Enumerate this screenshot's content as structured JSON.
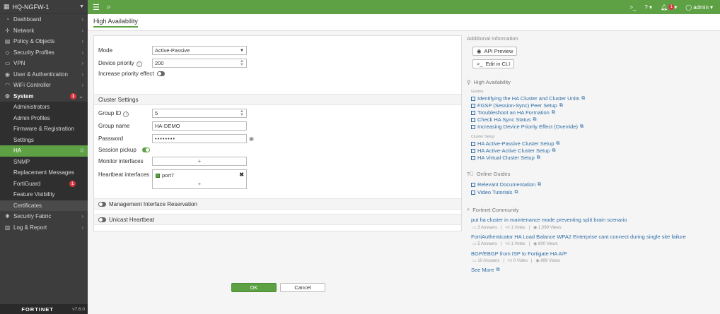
{
  "app": {
    "device_name": "HQ-NGFW-1",
    "logo": "FORTINET",
    "version": "v7.6.0"
  },
  "topbar": {
    "cli_icon": "terminal-icon",
    "help_icon": "help-icon",
    "bell_icon": "bell-icon",
    "notification_count": "1",
    "user": "admin"
  },
  "sidebar": {
    "items": [
      {
        "label": "Dashboard",
        "icon": "dashboard-icon"
      },
      {
        "label": "Network",
        "icon": "network-icon"
      },
      {
        "label": "Policy & Objects",
        "icon": "policy-icon"
      },
      {
        "label": "Security Profiles",
        "icon": "security-icon"
      },
      {
        "label": "VPN",
        "icon": "vpn-icon"
      },
      {
        "label": "User & Authentication",
        "icon": "user-icon"
      },
      {
        "label": "WiFi Controller",
        "icon": "wifi-icon"
      },
      {
        "label": "System",
        "icon": "gear-icon",
        "badge": "1"
      }
    ],
    "system_sub": [
      {
        "label": "Administrators"
      },
      {
        "label": "Admin Profiles"
      },
      {
        "label": "Firmware & Registration"
      },
      {
        "label": "Settings"
      },
      {
        "label": "HA"
      },
      {
        "label": "SNMP"
      },
      {
        "label": "Replacement Messages"
      },
      {
        "label": "FortiGuard",
        "badge": "1"
      },
      {
        "label": "Feature Visibility"
      },
      {
        "label": "Certificates"
      }
    ],
    "bottom_items": [
      {
        "label": "Security Fabric",
        "icon": "fabric-icon"
      },
      {
        "label": "Log & Report",
        "icon": "log-icon"
      }
    ]
  },
  "page": {
    "title": "High Availability"
  },
  "form": {
    "mode_label": "Mode",
    "mode_value": "Active-Passive",
    "device_priority_label": "Device priority",
    "device_priority_value": "200",
    "increase_priority_label": "Increase priority effect",
    "cluster_settings_heading": "Cluster Settings",
    "group_id_label": "Group ID",
    "group_id_value": "5",
    "group_name_label": "Group name",
    "group_name_value": "HA-DEMO",
    "password_label": "Password",
    "password_value": "••••••••",
    "session_pickup_label": "Session pickup",
    "monitor_interfaces_label": "Monitor interfaces",
    "add_symbol": "+",
    "heartbeat_interfaces_label": "Heartbeat interfaces",
    "heartbeat_port": "port7",
    "remove_symbol": "✖",
    "mgmt_reservation_label": "Management Interface Reservation",
    "unicast_heartbeat_label": "Unicast Heartbeat",
    "ok_label": "OK",
    "cancel_label": "Cancel"
  },
  "right_panel": {
    "additional_info": "Additional Information",
    "api_preview": "API Preview",
    "edit_cli": "Edit in CLI",
    "ha_heading": "High Availability",
    "guides_label": "Guides",
    "guides": [
      "Identifying the HA Cluster and Cluster Units",
      "FGSP (Session-Sync) Peer Setup",
      "Troubleshoot an HA Formation",
      "Check HA Sync Status",
      "Increasing Device Priority Effect (Override)"
    ],
    "cluster_setup_label": "Cluster Setup",
    "cluster_setup": [
      "HA Active-Passive Cluster Setup",
      "HA Active-Active Cluster Setup",
      "HA Virtual Cluster Setup"
    ],
    "online_guides_heading": "Online Guides",
    "online_guides": [
      "Relevant Documentation",
      "Video Tutorials"
    ],
    "community_heading": "Fortinet Community",
    "community": [
      {
        "title": "put ha cluster in maintenance mode preventing split brain scenario",
        "answers": "3 Answers",
        "votes": "1 Votes",
        "views": "1,099 Views"
      },
      {
        "title": "FortiAuthenticator HA Load Balance WPA2 Enterprise cant connect during single site failure",
        "answers": "5 Answers",
        "votes": "1 Votes",
        "views": "800 Views"
      },
      {
        "title": "BGP/EBGP from ISP to Fortigate HA A/P",
        "answers": "10 Answers",
        "votes": "0 Votes",
        "views": "899 Views"
      }
    ],
    "see_more": "See More"
  }
}
